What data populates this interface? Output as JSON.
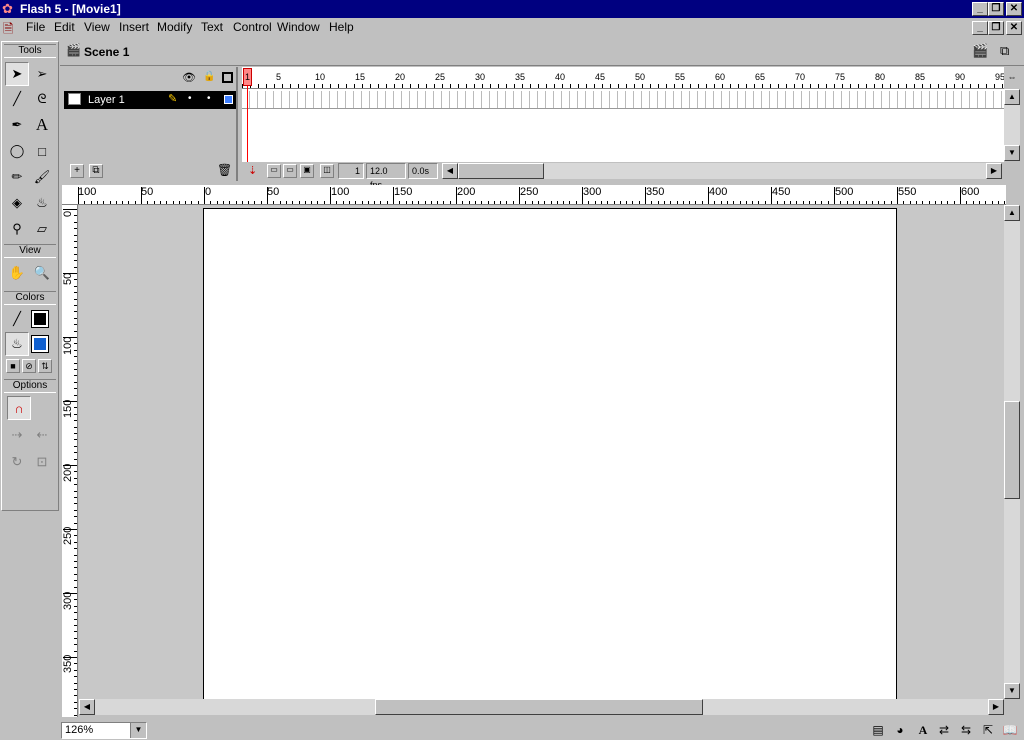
{
  "window": {
    "title": "Flash 5 - [Movie1]"
  },
  "menu": [
    "File",
    "Edit",
    "View",
    "Insert",
    "Modify",
    "Text",
    "Control",
    "Window",
    "Help"
  ],
  "tools": {
    "section_tools": "Tools",
    "section_view": "View",
    "section_colors": "Colors",
    "section_options": "Options",
    "stroke_color": "#000000",
    "fill_color": "#1060d0"
  },
  "scene": {
    "name": "Scene 1"
  },
  "timeline": {
    "layer_name": "Layer 1",
    "frame_numbers": [
      "1",
      "5",
      "10",
      "15",
      "20",
      "25",
      "30",
      "35",
      "40",
      "45",
      "50",
      "55",
      "60",
      "65",
      "70",
      "75",
      "80",
      "85",
      "90",
      "95"
    ],
    "current_frame": "1",
    "frame_rate": "12.0 fps",
    "elapsed": "0.0s"
  },
  "rulers": {
    "h_labels": [
      "100",
      "50",
      "0",
      "50",
      "100",
      "150",
      "200",
      "250",
      "300",
      "350",
      "400",
      "450",
      "500",
      "550",
      "600"
    ],
    "v_labels": [
      "0",
      "50",
      "100",
      "150",
      "200",
      "250",
      "300",
      "350"
    ]
  },
  "status": {
    "zoom": "126%"
  }
}
